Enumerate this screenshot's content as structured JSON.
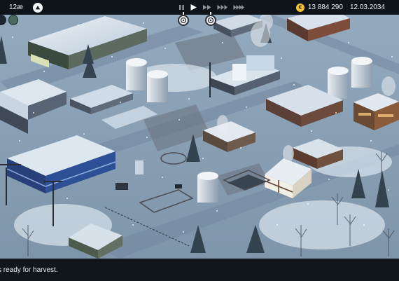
{
  "hud": {
    "population": "12æ",
    "money": "13 884 290",
    "coin_symbol": "€",
    "date": "12.03.2034"
  },
  "speed_controls": [
    "pause",
    "play",
    "fast-forward",
    "faster-forward",
    "fastest-forward"
  ],
  "notification": {
    "message": "s ready for harvest."
  },
  "colors": {
    "topbar": "#0f141b",
    "coin": "#f2c232",
    "snow": "#dbe5ee",
    "ground": "#8aa2b8"
  }
}
